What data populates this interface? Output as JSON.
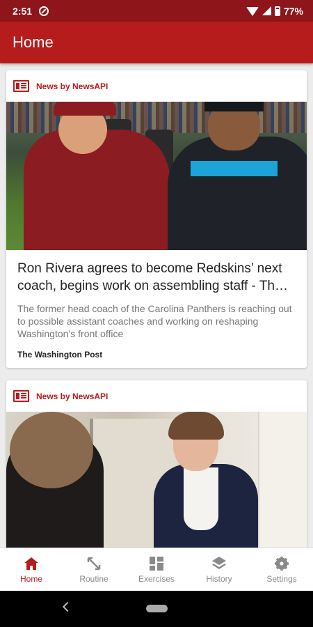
{
  "status_bar": {
    "time": "2:51",
    "battery": "77%"
  },
  "app_bar": {
    "title": "Home"
  },
  "articles": [
    {
      "source_label": "News by NewsAPI",
      "title": "Ron Rivera agrees to become Redskins’ next coach, begins work on assembling staff - Th…",
      "description": "The former head coach of the Carolina Panthers is reaching out to possible assistant coaches and working on reshaping Washington’s front office",
      "publisher": "The Washington Post"
    },
    {
      "source_label": "News by NewsAPI"
    }
  ],
  "bottom_nav": {
    "items": [
      {
        "label": "Home",
        "icon": "home-icon",
        "active": true
      },
      {
        "label": "Routine",
        "icon": "expand-arrows-icon",
        "active": false
      },
      {
        "label": "Exercises",
        "icon": "grid-icon",
        "active": false
      },
      {
        "label": "History",
        "icon": "layers-icon",
        "active": false
      },
      {
        "label": "Settings",
        "icon": "gear-icon",
        "active": false
      }
    ]
  },
  "colors": {
    "primary": "#b71c1c",
    "status_bar": "#8e1519",
    "inactive": "#8a8a8a"
  }
}
